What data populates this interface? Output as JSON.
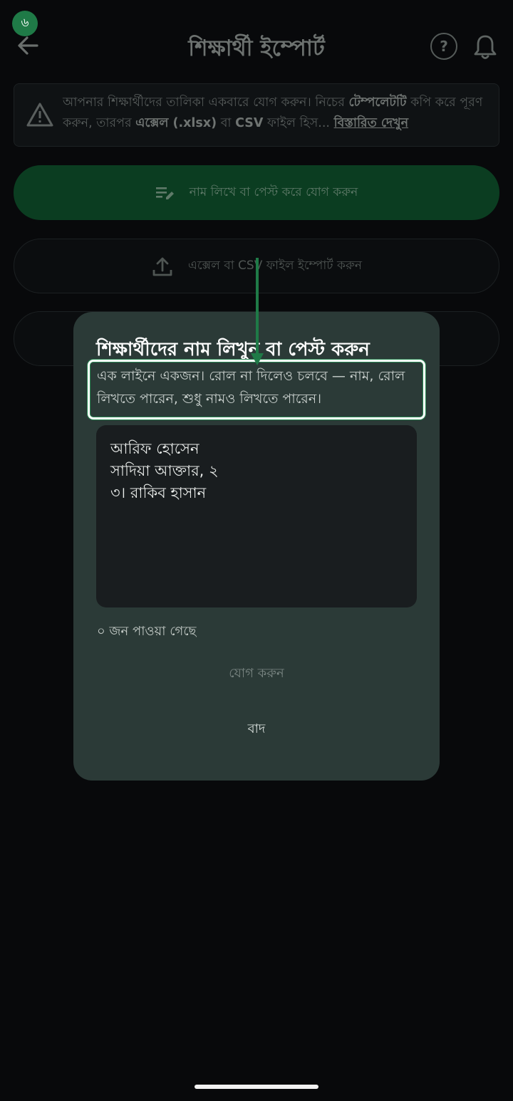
{
  "step_badge": "৬",
  "header": {
    "title": "শিক্ষার্থী ইম্পোর্ট",
    "help_symbol": "?",
    "icons": [
      "back-arrow-icon",
      "help-icon",
      "bell-icon"
    ]
  },
  "info_banner": {
    "text_1": "আপনার শিক্ষার্থীদের তালিকা একবারে যোগ করুন। নিচের ",
    "bold_template": "টেম্পলেটটি",
    "text_2": " কপি করে পূরণ করুন, তারপর ",
    "bold_excel": "এক্সেল (.xlsx)",
    "text_3": " বা ",
    "bold_csv": "CSV",
    "text_4": " ফাইল হিস... ",
    "more_link": "বিস্তারিত দেখুন",
    "icon": "warning-icon"
  },
  "options": {
    "write_label": "নাম লিখে বা পেস্ট করে যোগ করুন",
    "import_label": "এক্সেল বা CSV ফাইল ইম্পোর্ট করুন"
  },
  "dialog": {
    "title": "শিক্ষার্থীদের নাম লিখুন বা পেস্ট করুন",
    "hint": "এক লাইনে একজন। রোল না দিলেও চলবে — নাম, রোল লিখতে পারেন, শুধু নামও লিখতে পারেন।",
    "input_value": "আরিফ হোসেন\nসাদিয়া আক্তার, ২\n৩। রাকিব হাসান",
    "found_count": "০ জন পাওয়া গেছে",
    "add_button": "যোগ করুন",
    "cancel_button": "বাদ"
  },
  "colors": {
    "background": "#08090b",
    "dialog": "#2b3a37",
    "accent_green": "#1f7a47",
    "primary_button": "#0b3d21"
  }
}
